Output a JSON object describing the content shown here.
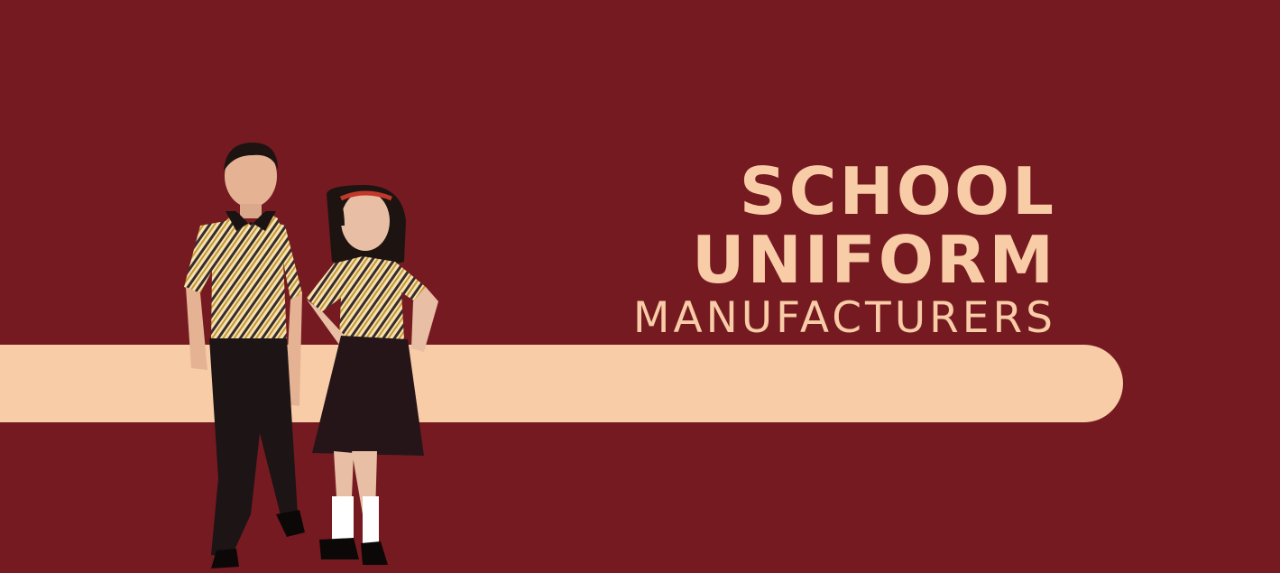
{
  "headline": {
    "line1": "SCHOOL",
    "line2": "UNIFORM",
    "line3": "MANUFACTURERS"
  },
  "colors": {
    "background": "#761a21",
    "accent": "#f8cca7"
  },
  "image": {
    "subject": "boy-and-girl-in-school-uniform"
  }
}
